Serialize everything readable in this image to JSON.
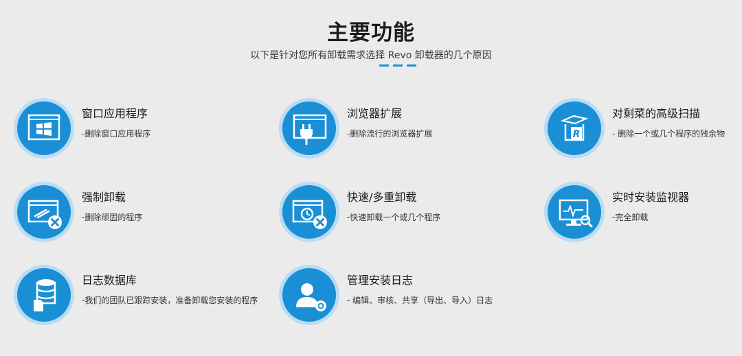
{
  "header": {
    "title": "主要功能",
    "subtitle": "以下是针对您所有卸载需求选择 Revo 卸载器的几个原因"
  },
  "colors": {
    "accent": "#1a8fd6",
    "ring": "#b8dcf3",
    "background": "#ebebeb"
  },
  "features": [
    {
      "title": "窗口应用程序",
      "desc": "-删除窗口应用程序",
      "icon": "windows-app-icon"
    },
    {
      "title": "浏览器扩展",
      "desc": "-删除流行的浏览器扩展",
      "icon": "browser-plugin-icon"
    },
    {
      "title": "对剩菜的高级扫描",
      "desc": "- 删除一个或几个程序的残余物",
      "icon": "leftovers-scan-icon"
    },
    {
      "title": "强制卸载",
      "desc": "-删除顽固的程序",
      "icon": "forced-uninstall-icon"
    },
    {
      "title": "快速/多重卸载",
      "desc": "-快速卸载一个或几个程序",
      "icon": "quick-uninstall-icon"
    },
    {
      "title": "实时安装监视器",
      "desc": "-完全卸载",
      "icon": "install-monitor-icon"
    },
    {
      "title": "日志数据库",
      "desc": "-我们的团队已跟踪安装，准备卸载您安装的程序",
      "icon": "logs-database-icon"
    },
    {
      "title": "管理安装日志",
      "desc": "- 编辑、审核、共享（导出、导入）日志",
      "icon": "manage-logs-icon"
    }
  ]
}
